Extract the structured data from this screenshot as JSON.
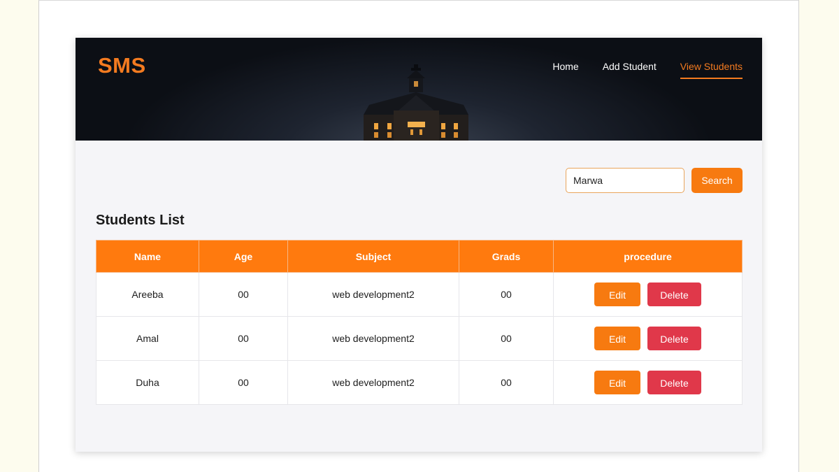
{
  "header": {
    "logo": "SMS",
    "nav": [
      {
        "label": "Home"
      },
      {
        "label": "Add Student"
      },
      {
        "label": "View Students"
      }
    ],
    "active_nav": "View Students"
  },
  "search": {
    "value": "Marwa",
    "button_label": "Search"
  },
  "list": {
    "title": "Students List",
    "columns": [
      "Name",
      "Age",
      "Subject",
      "Grads",
      "procedure"
    ],
    "rows": [
      {
        "name": "Areeba",
        "age": "00",
        "subject": "web development2",
        "grade": "00",
        "edit_label": "Edit",
        "delete_label": "Delete"
      },
      {
        "name": "Amal",
        "age": "00",
        "subject": "web development2",
        "grade": "00",
        "edit_label": "Edit",
        "delete_label": "Delete"
      },
      {
        "name": "Duha",
        "age": "00",
        "subject": "web development2",
        "grade": "00",
        "edit_label": "Edit",
        "delete_label": "Delete"
      }
    ]
  },
  "colors": {
    "accent": "#f77a10",
    "delete": "#e0384a",
    "header_bg": "#10141c"
  },
  "icons": [
    "school-building-image"
  ]
}
